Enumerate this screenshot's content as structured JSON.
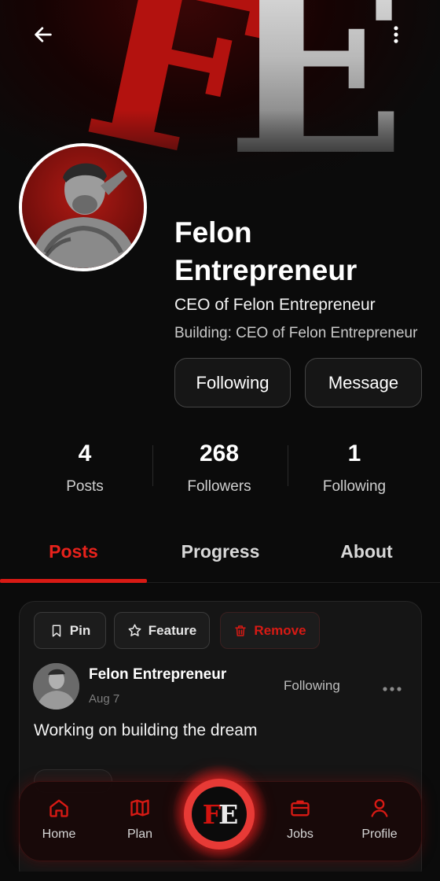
{
  "cover": {
    "logo_f": "F",
    "logo_e": "E"
  },
  "profile": {
    "name": "Felon Entrepreneur",
    "title": "CEO of Felon Entrepreneur",
    "building": "Building: CEO of Felon Entrepreneur"
  },
  "actions": {
    "following_label": "Following",
    "message_label": "Message"
  },
  "stats": [
    {
      "value": "4",
      "label": "Posts"
    },
    {
      "value": "268",
      "label": "Followers"
    },
    {
      "value": "1",
      "label": "Following"
    }
  ],
  "tabs": [
    {
      "label": "Posts",
      "active": true
    },
    {
      "label": "Progress",
      "active": false
    },
    {
      "label": "About",
      "active": false
    }
  ],
  "post": {
    "chips": {
      "pin": "Pin",
      "feature": "Feature",
      "remove": "Remove"
    },
    "author": "Felon Entrepreneur",
    "date": "Aug 7",
    "follow_status": "Following",
    "text": "Working on building the dream"
  },
  "nav": {
    "home": "Home",
    "plan": "Plan",
    "center_logo_f": "F",
    "center_logo_e": "E",
    "jobs": "Jobs",
    "profile": "Profile"
  },
  "colors": {
    "accent": "#d81a14",
    "background": "#0b0b0b",
    "card": "#151515"
  },
  "icons": [
    "back-arrow-icon",
    "more-vertical-icon",
    "bookmark-icon",
    "star-icon",
    "trash-icon",
    "more-horizontal-icon",
    "home-icon",
    "map-icon",
    "briefcase-icon",
    "user-icon"
  ]
}
